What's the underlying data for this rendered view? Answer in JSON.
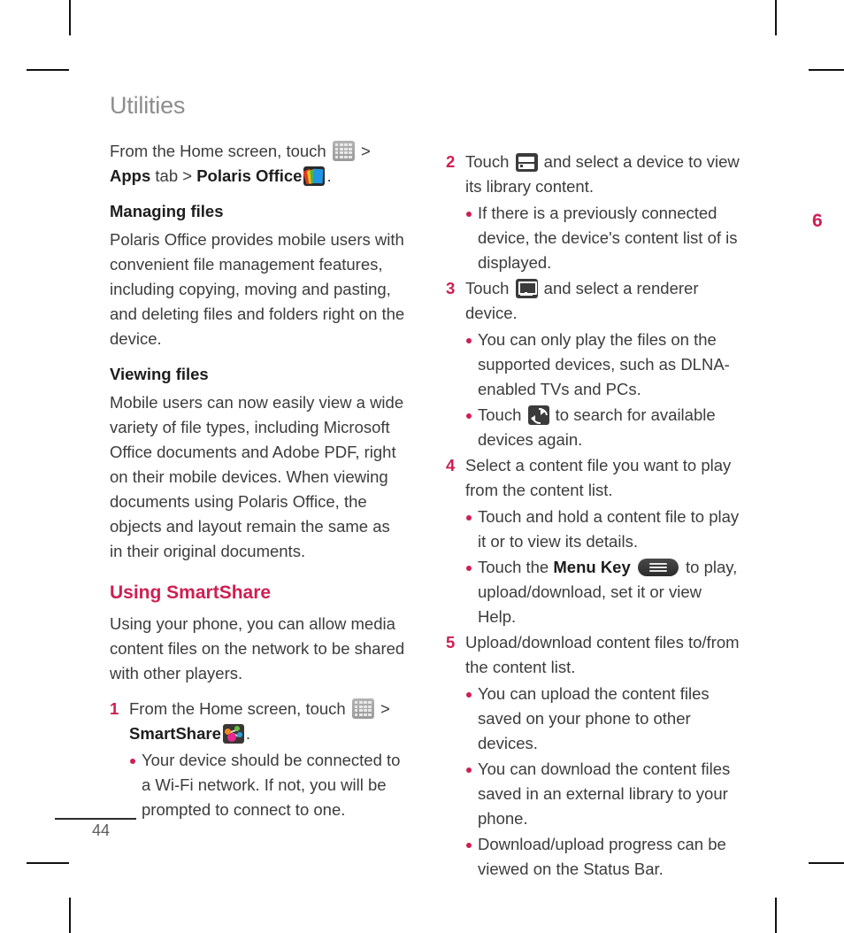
{
  "document": {
    "page_title": "Utilities",
    "page_number": "44",
    "chapter_tab": "6",
    "accent_color": "#cf1f52",
    "title_color": "#8d8d8d",
    "body_color": "#3c3c3c"
  },
  "left_column": {
    "intro": {
      "pre": "From the Home screen, touch",
      "icon_apps": "apps-grid-icon",
      "sep1": ">",
      "bold_apps": "Apps",
      "mid": "tab >",
      "bold_polaris": "Polaris Office",
      "icon_polaris": "polaris-office-icon",
      "period": "."
    },
    "managing_files_head": "Managing files",
    "managing_files_body": "Polaris Office provides mobile users with convenient file management features, including copying, moving and pasting, and deleting files and folders right on the device.",
    "viewing_files_head": "Viewing files",
    "viewing_files_body": "Mobile users can now easily view a wide variety of file types, including Microsoft Office documents and Adobe PDF, right on their mobile devices. When viewing documents using Polaris Office, the objects and layout remain the same as in their original documents.",
    "smartshare_head": "Using SmartShare",
    "smartshare_body": "Using your phone, you can allow media content files on the network to be shared with other players.",
    "step1": {
      "num": "1",
      "pre": "From the Home screen, touch",
      "icon_apps": "apps-grid-icon",
      "sep": ">",
      "bold_smartshare": "SmartShare",
      "icon_smartshare": "smartshare-icon",
      "period": ".",
      "bullets": [
        "Your device should be connected to a Wi-Fi network. If not, you will be prompted to connect to one."
      ]
    }
  },
  "right_column": {
    "step2": {
      "num": "2",
      "pre": "Touch",
      "icon_library": "library-device-icon",
      "post": "and select a device to view its library content.",
      "bullets": [
        "If there is a previously connected device, the device's content list of is displayed."
      ]
    },
    "step3": {
      "num": "3",
      "pre": "Touch",
      "icon_renderer": "renderer-monitor-icon",
      "post": "and select a renderer device.",
      "bullet1": "You can only play the files on the supported devices, such as DLNA-enabled TVs and PCs.",
      "bullet2_pre": "Touch",
      "icon_refresh": "refresh-icon",
      "bullet2_post": "to search for available devices again."
    },
    "step4": {
      "num": "4",
      "text": "Select a content file you want to play from the content list.",
      "bullet1": "Touch and hold a content file to play it or to view its details.",
      "bullet2_pre": "Touch the",
      "bullet2_bold": "Menu Key",
      "icon_menu": "menu-key-icon",
      "bullet2_post": "to play, upload/download, set it or view Help."
    },
    "step5": {
      "num": "5",
      "text": "Upload/download content files to/from the content list.",
      "bullets": [
        "You can upload the content files saved on your phone to other devices.",
        "You can download the content files saved in an external library to your phone.",
        "Download/upload progress can be viewed on the Status Bar."
      ]
    }
  }
}
